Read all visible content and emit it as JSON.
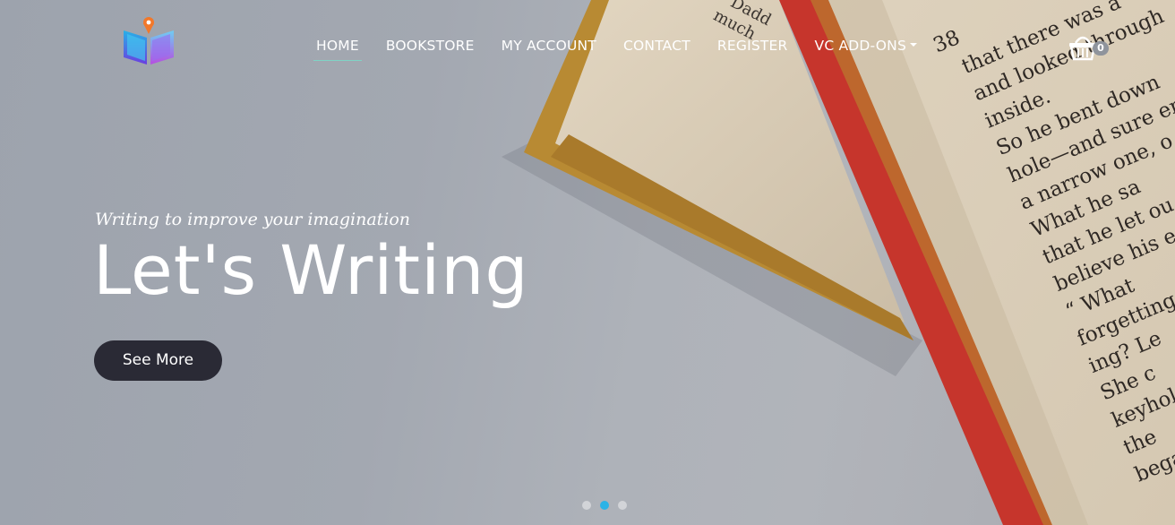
{
  "nav": {
    "items": [
      {
        "label": "HOME",
        "active": true
      },
      {
        "label": "BOOKSTORE",
        "active": false
      },
      {
        "label": "MY ACCOUNT",
        "active": false
      },
      {
        "label": "CONTACT",
        "active": false
      },
      {
        "label": "REGISTER",
        "active": false
      },
      {
        "label": "VC ADD-ONS",
        "active": false,
        "has_dropdown": true
      }
    ],
    "active_underline_color": "#7fd4c5"
  },
  "logo": {
    "icon": "open-book-pin-logo"
  },
  "cart": {
    "icon": "basket-icon",
    "count": "0"
  },
  "hero": {
    "subtitle": "Writing to improve your imagination",
    "headline": "Let's Writing",
    "cta_label": "See More",
    "cta_color": "#2a2a35"
  },
  "slider": {
    "dot_count": 3,
    "active_index": 1,
    "active_color": "#2cb3e6",
    "inactive_color": "#d2d4d8"
  },
  "book_page_text": [
    "38",
    "that there was a",
    "and looked through",
    "inside.",
    "So he bent down",
    "hole—and sure en",
    "a narrow one, o",
    "What he sa",
    "that he let ou",
    "believe his e",
    "“ What",
    "forgetting",
    "ing?  Le",
    "She c",
    "keyhol",
    "the",
    "bega"
  ],
  "book_corner_text": [
    "Dadd",
    "much"
  ]
}
